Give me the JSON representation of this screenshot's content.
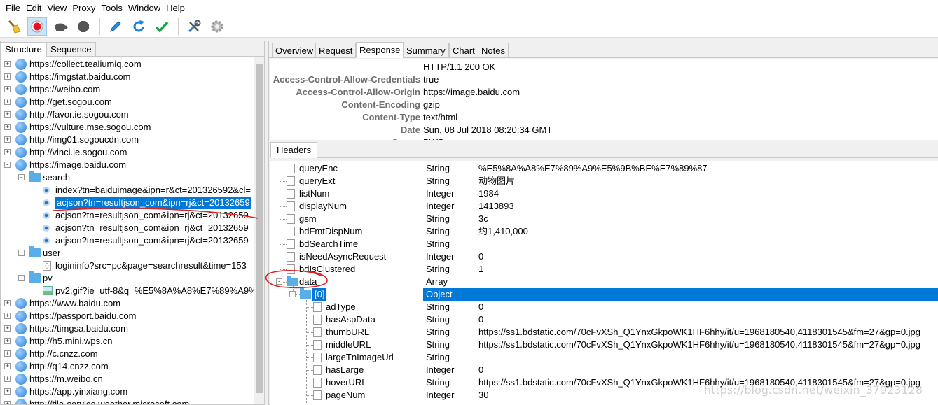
{
  "menu": [
    "File",
    "Edit",
    "View",
    "Proxy",
    "Tools",
    "Window",
    "Help"
  ],
  "toolbar": {
    "icons": [
      "broom-icon",
      "record-icon",
      "turtle-icon",
      "stop-icon",
      "pen-icon",
      "refresh-icon",
      "check-icon",
      "tools-icon",
      "gear-icon"
    ],
    "colors": {
      "record": "#e81123",
      "accent": "#0078d7",
      "check": "#1ea34a",
      "refresh": "#1e7fd6"
    }
  },
  "left_tabs": [
    "Structure",
    "Sequence"
  ],
  "tree": [
    {
      "kind": "host",
      "label": "https://collect.tealiumiq.com",
      "expand": "+"
    },
    {
      "kind": "host",
      "label": "https://imgstat.baidu.com",
      "expand": "+"
    },
    {
      "kind": "host",
      "label": "https://weibo.com",
      "expand": "+"
    },
    {
      "kind": "host",
      "label": "http://get.sogou.com",
      "expand": "+"
    },
    {
      "kind": "host",
      "label": "http://favor.ie.sogou.com",
      "expand": "+"
    },
    {
      "kind": "host",
      "label": "https://vulture.mse.sogou.com",
      "expand": "+"
    },
    {
      "kind": "host",
      "label": "http://img01.sogoucdn.com",
      "expand": "+"
    },
    {
      "kind": "host",
      "label": "http://vinci.ie.sogou.com",
      "expand": "+"
    },
    {
      "kind": "host",
      "label": "https://image.baidu.com",
      "expand": "-"
    },
    {
      "kind": "folder",
      "label": "search",
      "expand": "-"
    },
    {
      "kind": "request",
      "label": "index?tn=baiduimage&ipn=r&ct=201326592&cl="
    },
    {
      "kind": "request",
      "label": "acjson?tn=resultjson_com&ipn=rj&ct=20132659",
      "selected": true
    },
    {
      "kind": "request",
      "label": "acjson?tn=resultjson_com&ipn=rj&ct=20132659"
    },
    {
      "kind": "request",
      "label": "acjson?tn=resultjson_com&ipn=rj&ct=20132659"
    },
    {
      "kind": "request",
      "label": "acjson?tn=resultjson_com&ipn=rj&ct=20132659"
    },
    {
      "kind": "folder",
      "label": "user",
      "expand": "-"
    },
    {
      "kind": "json",
      "label": "logininfo?src=pc&page=searchresult&time=153"
    },
    {
      "kind": "folder",
      "label": "pv",
      "expand": "-"
    },
    {
      "kind": "image",
      "label": "pv2.gif?ie=utf-8&q=%E5%8A%A8%E7%89%A9%"
    },
    {
      "kind": "host",
      "label": "https://www.baidu.com",
      "expand": "+"
    },
    {
      "kind": "host",
      "label": "https://passport.baidu.com",
      "expand": "+"
    },
    {
      "kind": "host",
      "label": "https://timgsa.baidu.com",
      "expand": "+"
    },
    {
      "kind": "host",
      "label": "http://h5.mini.wps.cn",
      "expand": "+"
    },
    {
      "kind": "host",
      "label": "http://c.cnzz.com",
      "expand": "+"
    },
    {
      "kind": "host",
      "label": "http://q14.cnzz.com",
      "expand": "+"
    },
    {
      "kind": "host",
      "label": "https://m.weibo.cn",
      "expand": "+"
    },
    {
      "kind": "host",
      "label": "https://app.yinxiang.com",
      "expand": "+"
    },
    {
      "kind": "host",
      "label": "http://tile-service.weather.microsoft.com",
      "expand": "+"
    }
  ],
  "right_tabs": [
    "Overview",
    "Request",
    "Response",
    "Summary",
    "Chart",
    "Notes"
  ],
  "response_headers": [
    {
      "key": "",
      "value": "HTTP/1.1 200 OK"
    },
    {
      "key": "Access-Control-Allow-Credentials",
      "value": "true"
    },
    {
      "key": "Access-Control-Allow-Origin",
      "value": "https://image.baidu.com"
    },
    {
      "key": "Content-Encoding",
      "value": "gzip"
    },
    {
      "key": "Content-Type",
      "value": "text/html"
    },
    {
      "key": "Date",
      "value": "Sun, 08 Jul 2018 08:20:34 GMT"
    },
    {
      "key": "Server",
      "value": "BWS"
    }
  ],
  "sub_tab": "Headers",
  "json_rows": [
    {
      "name": "queryEnc",
      "type": "String",
      "value": "%E5%8A%A8%E7%89%A9%E5%9B%BE%E7%89%87",
      "level": 0,
      "kind": "leaf"
    },
    {
      "name": "queryExt",
      "type": "String",
      "value": "动物图片",
      "level": 0,
      "kind": "leaf"
    },
    {
      "name": "listNum",
      "type": "Integer",
      "value": "1984",
      "level": 0,
      "kind": "leaf"
    },
    {
      "name": "displayNum",
      "type": "Integer",
      "value": "1413893",
      "level": 0,
      "kind": "leaf"
    },
    {
      "name": "gsm",
      "type": "String",
      "value": "3c",
      "level": 0,
      "kind": "leaf"
    },
    {
      "name": "bdFmtDispNum",
      "type": "String",
      "value": "约1,410,000",
      "level": 0,
      "kind": "leaf"
    },
    {
      "name": "bdSearchTime",
      "type": "String",
      "value": "",
      "level": 0,
      "kind": "leaf"
    },
    {
      "name": "isNeedAsyncRequest",
      "type": "Integer",
      "value": "0",
      "level": 0,
      "kind": "leaf"
    },
    {
      "name": "bdIsClustered",
      "type": "String",
      "value": "1",
      "level": 0,
      "kind": "leaf"
    },
    {
      "name": "data",
      "type": "Array",
      "value": "",
      "level": 0,
      "kind": "folder",
      "expand": "-"
    },
    {
      "name": "[0]",
      "type": "Object",
      "value": "",
      "level": 1,
      "kind": "folder",
      "expand": "-",
      "selected": true
    },
    {
      "name": "adType",
      "type": "String",
      "value": "0",
      "level": 2,
      "kind": "leaf"
    },
    {
      "name": "hasAspData",
      "type": "String",
      "value": "0",
      "level": 2,
      "kind": "leaf"
    },
    {
      "name": "thumbURL",
      "type": "String",
      "value": "https://ss1.bdstatic.com/70cFvXSh_Q1YnxGkpoWK1HF6hhy/it/u=1968180540,4118301545&fm=27&gp=0.jpg",
      "level": 2,
      "kind": "leaf"
    },
    {
      "name": "middleURL",
      "type": "String",
      "value": "https://ss1.bdstatic.com/70cFvXSh_Q1YnxGkpoWK1HF6hhy/it/u=1968180540,4118301545&fm=27&gp=0.jpg",
      "level": 2,
      "kind": "leaf"
    },
    {
      "name": "largeTnImageUrl",
      "type": "String",
      "value": "",
      "level": 2,
      "kind": "leaf"
    },
    {
      "name": "hasLarge",
      "type": "Integer",
      "value": "0",
      "level": 2,
      "kind": "leaf"
    },
    {
      "name": "hoverURL",
      "type": "String",
      "value": "https://ss1.bdstatic.com/70cFvXSh_Q1YnxGkpoWK1HF6hhy/it/u=1968180540,4118301545&fm=27&gp=0.jpg",
      "level": 2,
      "kind": "leaf"
    },
    {
      "name": "pageNum",
      "type": "Integer",
      "value": "30",
      "level": 2,
      "kind": "leaf"
    }
  ],
  "watermark": "https://blog.csdn.net/weixin_37923128"
}
